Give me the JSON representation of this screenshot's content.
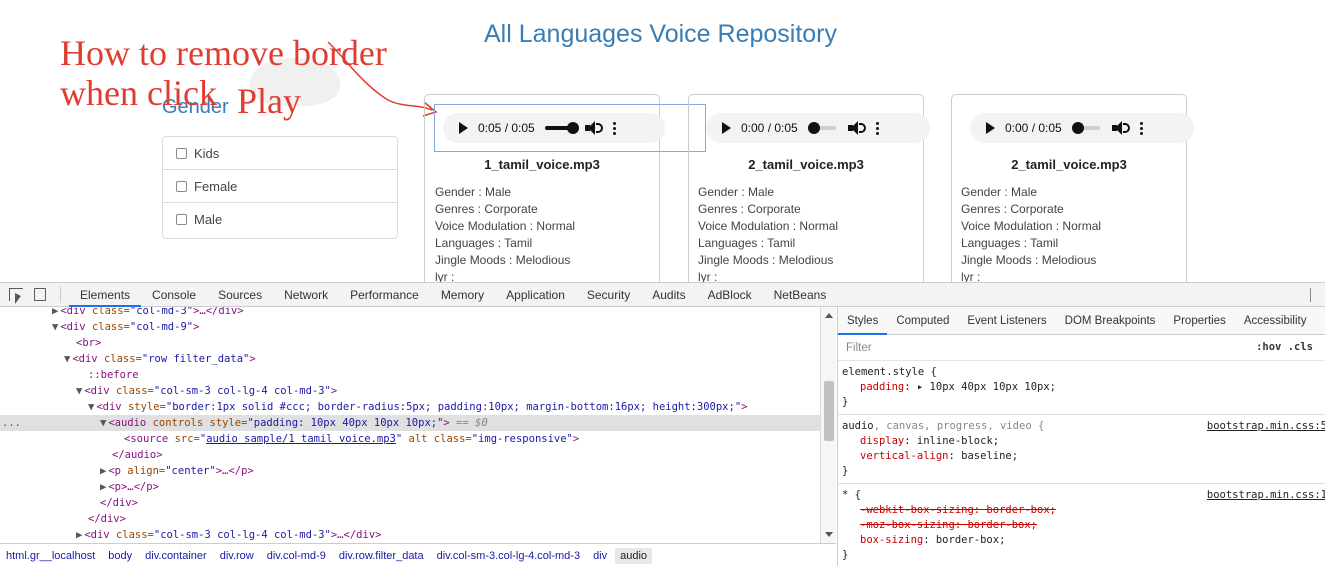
{
  "page": {
    "title": "All Languages Voice Repository",
    "annotation_line1": "How to remove border",
    "annotation_line2": "when click",
    "annotation_line3": "Play",
    "gender_heading": "Gender",
    "filters": [
      "Kids",
      "Female",
      "Male"
    ],
    "cards": [
      {
        "player_time": "0:05 / 0:05",
        "progress": 1.0,
        "title": "1_tamil_voice.mp3",
        "info": [
          "Gender : Male",
          "Genres : Corporate",
          "Voice Modulation : Normal",
          "Languages : Tamil",
          "Jingle Moods : Melodious",
          "lyr :"
        ]
      },
      {
        "player_time": "0:00 / 0:05",
        "progress": 0.0,
        "title": "2_tamil_voice.mp3",
        "info": [
          "Gender : Male",
          "Genres : Corporate",
          "Voice Modulation : Normal",
          "Languages : Tamil",
          "Jingle Moods : Melodious",
          "lyr :"
        ]
      },
      {
        "player_time": "0:00 / 0:05",
        "progress": 0.0,
        "title": "2_tamil_voice.mp3",
        "info": [
          "Gender : Male",
          "Genres : Corporate",
          "Voice Modulation : Normal",
          "Languages : Tamil",
          "Jingle Moods : Melodious",
          "lyr :"
        ]
      }
    ]
  },
  "devtools": {
    "tabs": [
      "Elements",
      "Console",
      "Sources",
      "Network",
      "Performance",
      "Memory",
      "Application",
      "Security",
      "Audits",
      "AdBlock",
      "NetBeans"
    ],
    "active_tab": "Elements",
    "dom": {
      "l1_tag": "<div ",
      "l1_attr": "class=",
      "l1_val": "\"col-md-3\"",
      "l1_rest": ">…</div>",
      "l2_tag": "<div ",
      "l2_attr": "class=",
      "l2_val": "\"col-md-9\"",
      "l2_close": ">",
      "l3": "<br>",
      "l4_tag": "<div ",
      "l4_attr": "class=",
      "l4_val": "\"row filter_data\"",
      "l4_close": ">",
      "l5": "::before",
      "l6_tag": "<div ",
      "l6_attr": "class=",
      "l6_val": "\"col-sm-3 col-lg-4 col-md-3\"",
      "l6_close": ">",
      "l7_tag": "<div ",
      "l7_attr": "style=",
      "l7_val": "\"border:1px solid #ccc; border-radius:5px; padding:10px; margin-bottom:16px; height:300px;\"",
      "l7_close": ">",
      "l8_tag": "<audio ",
      "l8_attr1": "controls ",
      "l8_attr2": "style=",
      "l8_val": "\"padding: 10px 40px 10px 10px;\"",
      "l8_close": ">",
      "l8_eq": " == $0",
      "l9_tag": "<source ",
      "l9_attr1": "src=",
      "l9_q1": "\"",
      "l9_link": "audio sample/1 tamil voice.mp3",
      "l9_q2": "\"",
      "l9_attr2": " alt ",
      "l9_attr3": "class=",
      "l9_val": "\"img-responsive\"",
      "l9_close": ">",
      "l10": "</audio>",
      "l11_tag": "<p ",
      "l11_attr": "align=",
      "l11_val": "\"center\"",
      "l11_rest": ">…</p>",
      "l12": "<p>…</p>",
      "l13": "</div>",
      "l14": "</div>",
      "l15_tag": "<div ",
      "l15_attr": "class=",
      "l15_val": "\"col-sm-3 col-lg-4 col-md-3\"",
      "l15_rest": ">…</div>",
      "ellipsis": "..."
    },
    "breadcrumb": [
      "html.gr__localhost",
      "body",
      "div.container",
      "div.row",
      "div.col-md-9",
      "div.row.filter_data",
      "div.col-sm-3.col-lg-4.col-md-3",
      "div",
      "audio"
    ],
    "styles_tabs": [
      "Styles",
      "Computed",
      "Event Listeners",
      "DOM Breakpoints",
      "Properties",
      "Accessibility"
    ],
    "filter_placeholder": "Filter",
    "filter_opts": ":hov  .cls",
    "rules": {
      "r1_selector": "element.style {",
      "r1_p1_name": "padding",
      "r1_p1_val": ": ▸ 10px 40px 10px 10px;",
      "r2_selector_main": "audio",
      "r2_selector_rest": ", canvas, progress, video {",
      "r2_src": "bootstrap.min.css:5",
      "r2_p1_name": "display",
      "r2_p1_val": ": inline-block;",
      "r2_p2_name": "vertical-align",
      "r2_p2_val": ": baseline;",
      "r3_selector": "* {",
      "r3_src": "bootstrap.min.css:1",
      "r3_p1": "-webkit-box-sizing: border-box;",
      "r3_p2": "-moz-box-sizing: border-box;",
      "r3_p3_name": "box-sizing",
      "r3_p3_val": ": border-box;",
      "close": "}"
    }
  }
}
